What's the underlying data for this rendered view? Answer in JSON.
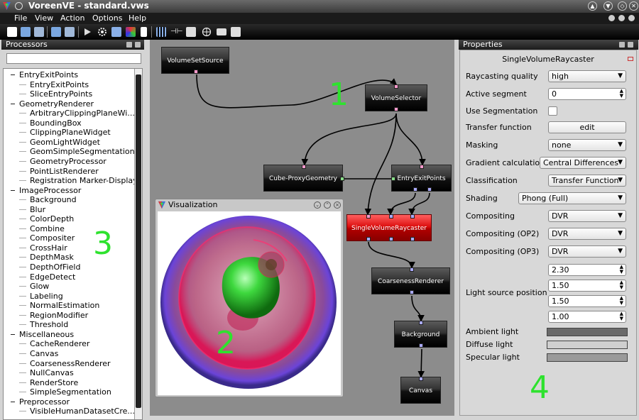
{
  "window": {
    "title": "VoreenVE  - standard.vws"
  },
  "menu": {
    "items": [
      {
        "label": "File",
        "mnemonic": "F"
      },
      {
        "label": "View",
        "mnemonic": "V"
      },
      {
        "label": "Action",
        "mnemonic": "A"
      },
      {
        "label": "Options",
        "mnemonic": "O"
      },
      {
        "label": "Help",
        "mnemonic": "H"
      }
    ]
  },
  "processors_panel": {
    "title": "Processors",
    "filter_value": "",
    "tree": [
      {
        "label": "EntryExitPoints",
        "kind": "category"
      },
      {
        "label": "EntryExitPoints",
        "kind": "leaf"
      },
      {
        "label": "SliceEntryPoints",
        "kind": "leaf"
      },
      {
        "label": "GeometryRenderer",
        "kind": "category"
      },
      {
        "label": "ArbitraryClippingPlaneWi...",
        "kind": "leaf"
      },
      {
        "label": "BoundingBox",
        "kind": "leaf"
      },
      {
        "label": "ClippingPlaneWidget",
        "kind": "leaf"
      },
      {
        "label": "GeomLightWidget",
        "kind": "leaf"
      },
      {
        "label": "GeomSimpleSegmentation",
        "kind": "leaf"
      },
      {
        "label": "GeometryProcessor",
        "kind": "leaf"
      },
      {
        "label": "PointListRenderer",
        "kind": "leaf"
      },
      {
        "label": "Registration Marker-Display",
        "kind": "leaf"
      },
      {
        "label": "ImageProcessor",
        "kind": "category"
      },
      {
        "label": "Background",
        "kind": "leaf"
      },
      {
        "label": "Blur",
        "kind": "leaf"
      },
      {
        "label": "ColorDepth",
        "kind": "leaf"
      },
      {
        "label": "Combine",
        "kind": "leaf"
      },
      {
        "label": "Compositer",
        "kind": "leaf"
      },
      {
        "label": "CrossHair",
        "kind": "leaf"
      },
      {
        "label": "DepthMask",
        "kind": "leaf"
      },
      {
        "label": "DepthOfField",
        "kind": "leaf"
      },
      {
        "label": "EdgeDetect",
        "kind": "leaf"
      },
      {
        "label": "Glow",
        "kind": "leaf"
      },
      {
        "label": "Labeling",
        "kind": "leaf"
      },
      {
        "label": "NormalEstimation",
        "kind": "leaf"
      },
      {
        "label": "RegionModifier",
        "kind": "leaf"
      },
      {
        "label": "Threshold",
        "kind": "leaf"
      },
      {
        "label": "Miscellaneous",
        "kind": "category"
      },
      {
        "label": "CacheRenderer",
        "kind": "leaf"
      },
      {
        "label": "Canvas",
        "kind": "leaf"
      },
      {
        "label": "CoarsenessRenderer",
        "kind": "leaf"
      },
      {
        "label": "NullCanvas",
        "kind": "leaf"
      },
      {
        "label": "RenderStore",
        "kind": "leaf"
      },
      {
        "label": "SimpleSegmentation",
        "kind": "leaf"
      },
      {
        "label": "Preprocessor",
        "kind": "category"
      },
      {
        "label": "VisibleHumanDatasetCre...",
        "kind": "leaf"
      }
    ]
  },
  "network": {
    "nodes": {
      "volumesetsource": "VolumeSetSource",
      "volumeselector": "VolumeSelector",
      "cubeproxy": "Cube-ProxyGeometry",
      "entryexit": "EntryExitPoints",
      "raycaster": "SingleVolumeRaycaster",
      "coarseness": "CoarsenessRenderer",
      "background": "Background",
      "canvas": "Canvas"
    }
  },
  "visualization": {
    "title": "Visualization"
  },
  "annotations": {
    "n1": "1",
    "n2": "2",
    "n3": "3",
    "n4": "4"
  },
  "properties": {
    "panel_title": "Properties",
    "processor_name": "SingleVolumeRaycaster",
    "rows": {
      "raycasting_quality": {
        "label": "Raycasting quality",
        "value": "high"
      },
      "active_segment": {
        "label": "Active segment",
        "value": "0"
      },
      "use_segmentation": {
        "label": "Use Segmentation",
        "checked": false
      },
      "transfer_function": {
        "label": "Transfer function",
        "button": "edit"
      },
      "masking": {
        "label": "Masking",
        "value": "none"
      },
      "gradient_calculation": {
        "label": "Gradient calculation",
        "value": "Central Differences"
      },
      "classification": {
        "label": "Classification",
        "value": "Transfer Function"
      },
      "shading": {
        "label": "Shading",
        "value": "Phong (Full)"
      },
      "compositing": {
        "label": "Compositing",
        "value": "DVR"
      },
      "compositing_op2": {
        "label": "Compositing (OP2)",
        "value": "DVR"
      },
      "compositing_op3": {
        "label": "Compositing (OP3)",
        "value": "DVR"
      },
      "light_source_position": {
        "label": "Light source position",
        "values": [
          "2.30",
          "1.50",
          "1.50",
          "1.00"
        ]
      },
      "ambient_light": {
        "label": "Ambient light",
        "color": "#6a6a6a"
      },
      "diffuse_light": {
        "label": "Diffuse light",
        "color": "#cfcfcf"
      },
      "specular_light": {
        "label": "Specular light",
        "color": "#9a9a9a"
      }
    }
  },
  "colors": {
    "annotation_green": "#2ee22e",
    "selected_node": "#dd1010"
  }
}
